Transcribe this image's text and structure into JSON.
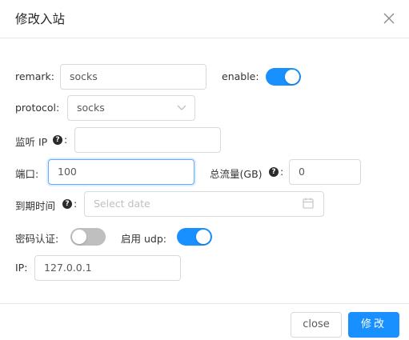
{
  "dialog": {
    "title": "修改入站",
    "close_icon": "close-icon"
  },
  "form": {
    "remark": {
      "label": "remark:",
      "value": "socks"
    },
    "enable": {
      "label": "enable:",
      "on": true
    },
    "protocol": {
      "label": "protocol:",
      "value": "socks"
    },
    "listen_ip": {
      "label": "监听 IP",
      "colon": ":",
      "value": ""
    },
    "port": {
      "label": "端口:",
      "value": "100"
    },
    "total_traffic": {
      "label": "总流量(GB)",
      "colon": ":",
      "value": "0"
    },
    "expiry": {
      "label": "到期时间",
      "colon": ":",
      "placeholder": "Select date"
    },
    "password_auth": {
      "label": "密码认证:",
      "on": false
    },
    "udp": {
      "label": "启用 udp:",
      "on": true
    },
    "ip": {
      "label": "IP:",
      "value": "127.0.0.1"
    }
  },
  "footer": {
    "cancel_label": "close",
    "submit_label": "修改"
  },
  "colors": {
    "primary": "#1890ff",
    "toggle_off": "#bfbfbf"
  }
}
